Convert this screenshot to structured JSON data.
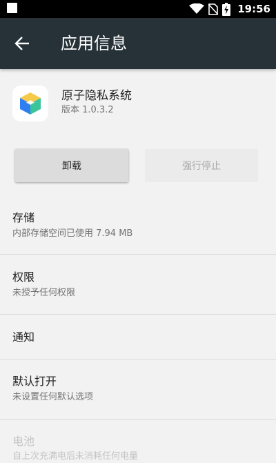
{
  "status_bar": {
    "time": "19:56"
  },
  "app_bar": {
    "title": "应用信息",
    "back_icon": "arrow-back-icon"
  },
  "app": {
    "name": "原子隐私系统",
    "version": "版本 1.0.3.2",
    "icon": "app-cube-icon"
  },
  "buttons": {
    "uninstall": "卸载",
    "force_stop": "强行停止"
  },
  "sections": [
    {
      "title": "存储",
      "summary": "内部存储空间已使用 7.94 MB"
    },
    {
      "title": "权限",
      "summary": "未授予任何权限"
    },
    {
      "title": "通知",
      "summary": ""
    },
    {
      "title": "默认打开",
      "summary": "未设置任何默认选项"
    },
    {
      "title": "电池",
      "summary": "自上次充满电后未消耗任何电量"
    }
  ],
  "colors": {
    "app_bar": "#263238",
    "status_bar": "#000000",
    "background": "#f2f2f2"
  }
}
